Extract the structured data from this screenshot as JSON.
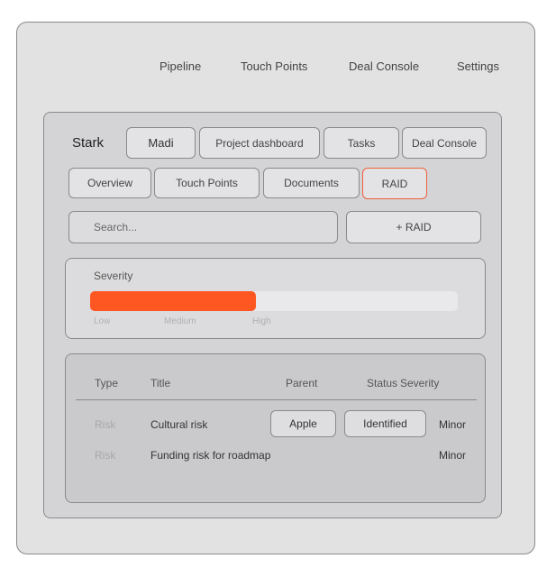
{
  "top_nav": [
    "Pipeline",
    "Touch Points",
    "Deal Console",
    "Settings"
  ],
  "project": {
    "title": "Stark",
    "header_buttons": [
      "Madi",
      "Project dashboard",
      "Tasks",
      "Deal Console"
    ]
  },
  "tabs": [
    {
      "label": "Overview",
      "active": false
    },
    {
      "label": "Touch Points",
      "active": false
    },
    {
      "label": "Documents",
      "active": false
    },
    {
      "label": "RAID",
      "active": true
    }
  ],
  "search": {
    "placeholder": "Search..."
  },
  "add_button": "+ RAID",
  "severity": {
    "label": "Severity",
    "levels": [
      "Low",
      "Medium",
      "High"
    ],
    "fill_fraction": 0.45,
    "fill_color": "#ff5722"
  },
  "table": {
    "columns": [
      "Type",
      "Title",
      "Parent",
      "Status",
      "Severity"
    ],
    "rows": [
      {
        "type": "Risk",
        "title": "Cultural risk",
        "parent": "Apple",
        "status": "Identified",
        "severity": "Minor"
      },
      {
        "type": "Risk",
        "title": "Funding risk for roadmap",
        "parent": "",
        "status": "",
        "severity": "Minor"
      }
    ]
  },
  "colors": {
    "accent": "#ff5722",
    "frame": "#e2e2e3",
    "panel": "#d4d4d6"
  }
}
